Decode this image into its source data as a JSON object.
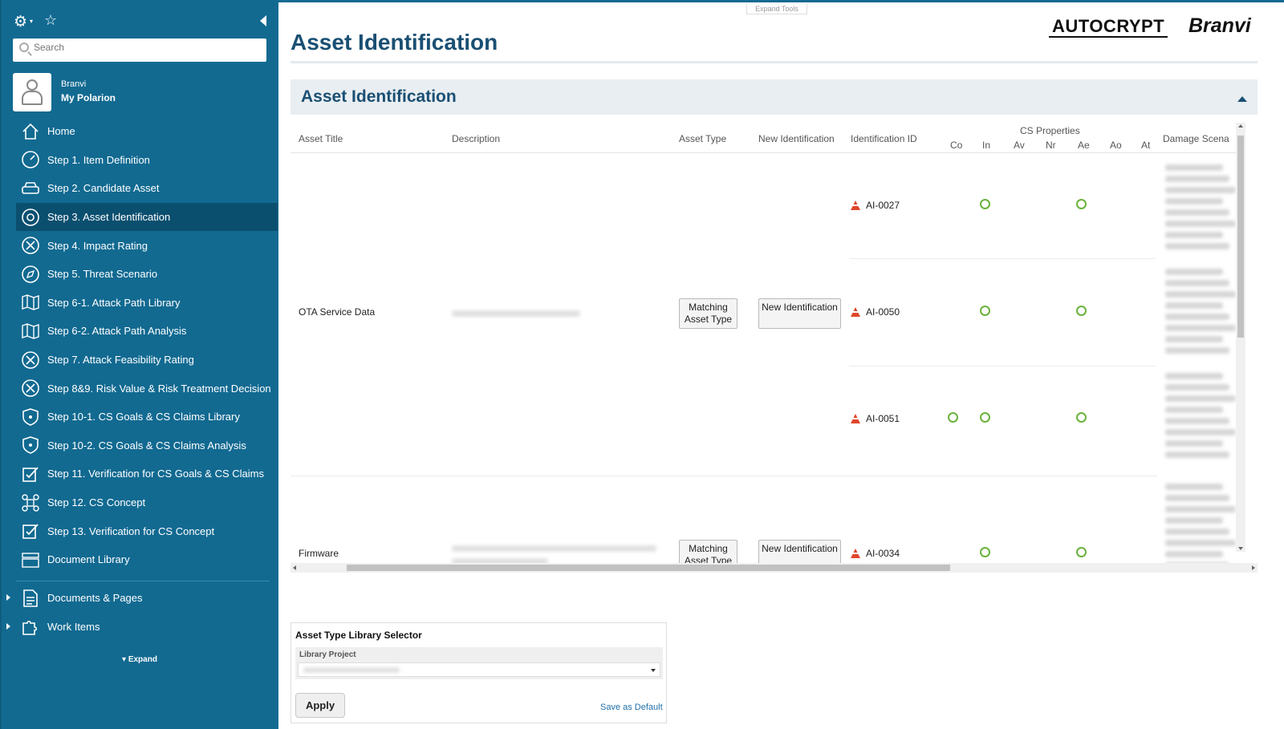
{
  "sidebar": {
    "search_placeholder": "Search",
    "user": {
      "name": "Branvi",
      "link": "My Polarion"
    },
    "items": [
      {
        "label": "Home",
        "icon": "home-icon"
      },
      {
        "label": "Step 1. Item Definition",
        "icon": "gauge-icon"
      },
      {
        "label": "Step 2. Candidate Asset",
        "icon": "car-icon"
      },
      {
        "label": "Step 3. Asset Identification",
        "icon": "target-icon",
        "active": true
      },
      {
        "label": "Step 4. Impact Rating",
        "icon": "impact-icon"
      },
      {
        "label": "Step 5. Threat Scenario",
        "icon": "compass-icon"
      },
      {
        "label": "Step 6-1. Attack Path Library",
        "icon": "map-icon"
      },
      {
        "label": "Step 6-2. Attack Path Analysis",
        "icon": "map-icon"
      },
      {
        "label": "Step 7. Attack Feasibility Rating",
        "icon": "impact-icon"
      },
      {
        "label": "Step 8&9. Risk Value & Risk Treatment Decision",
        "icon": "impact-icon"
      },
      {
        "label": "Step 10-1. CS Goals & CS Claims Library",
        "icon": "shield-icon"
      },
      {
        "label": "Step 10-2. CS Goals & CS Claims Analysis",
        "icon": "shield-icon"
      },
      {
        "label": "Step 11. Verification for CS Goals & CS Claims",
        "icon": "checklist-icon"
      },
      {
        "label": "Step 12. CS Concept",
        "icon": "network-icon"
      },
      {
        "label": "Step 13. Verification for CS Concept",
        "icon": "checklist-icon"
      },
      {
        "label": "Document Library",
        "icon": "library-icon"
      }
    ],
    "bottom_items": [
      {
        "label": "Documents & Pages",
        "icon": "document-icon"
      },
      {
        "label": "Work Items",
        "icon": "puzzle-icon"
      }
    ],
    "expand_label": "Expand"
  },
  "main": {
    "expand_tools": "Expand Tools",
    "page_title": "Asset Identification",
    "logos": {
      "autocrypt": "AUTOCRYPT",
      "branvi": "Branvi"
    },
    "section_title": "Asset Identification",
    "table": {
      "headers": {
        "asset_title": "Asset Title",
        "description": "Description",
        "asset_type": "Asset Type",
        "new_identification": "New Identification",
        "identification_id": "Identification ID",
        "cs_properties": "CS Properties",
        "damage": "Damage Scena"
      },
      "cs_cols": [
        "Co",
        "In",
        "Av",
        "Nr",
        "Ae",
        "Ao",
        "At"
      ],
      "matching_btn": "Matching Asset Type",
      "new_btn": "New Identification",
      "assets": [
        {
          "title": "OTA Service Data"
        },
        {
          "title": "Firmware"
        }
      ],
      "ids": [
        "AI-0027",
        "AI-0050",
        "AI-0051",
        "AI-0034"
      ]
    },
    "selector": {
      "title": "Asset Type Library Selector",
      "library_label": "Library Project",
      "apply": "Apply",
      "save_default": "Save as Default"
    }
  },
  "colors": {
    "sidebar": "#126a91",
    "active": "#0b4f6f",
    "title": "#1a4f73",
    "check": "#6ab23c",
    "cone": "#e0462b"
  }
}
